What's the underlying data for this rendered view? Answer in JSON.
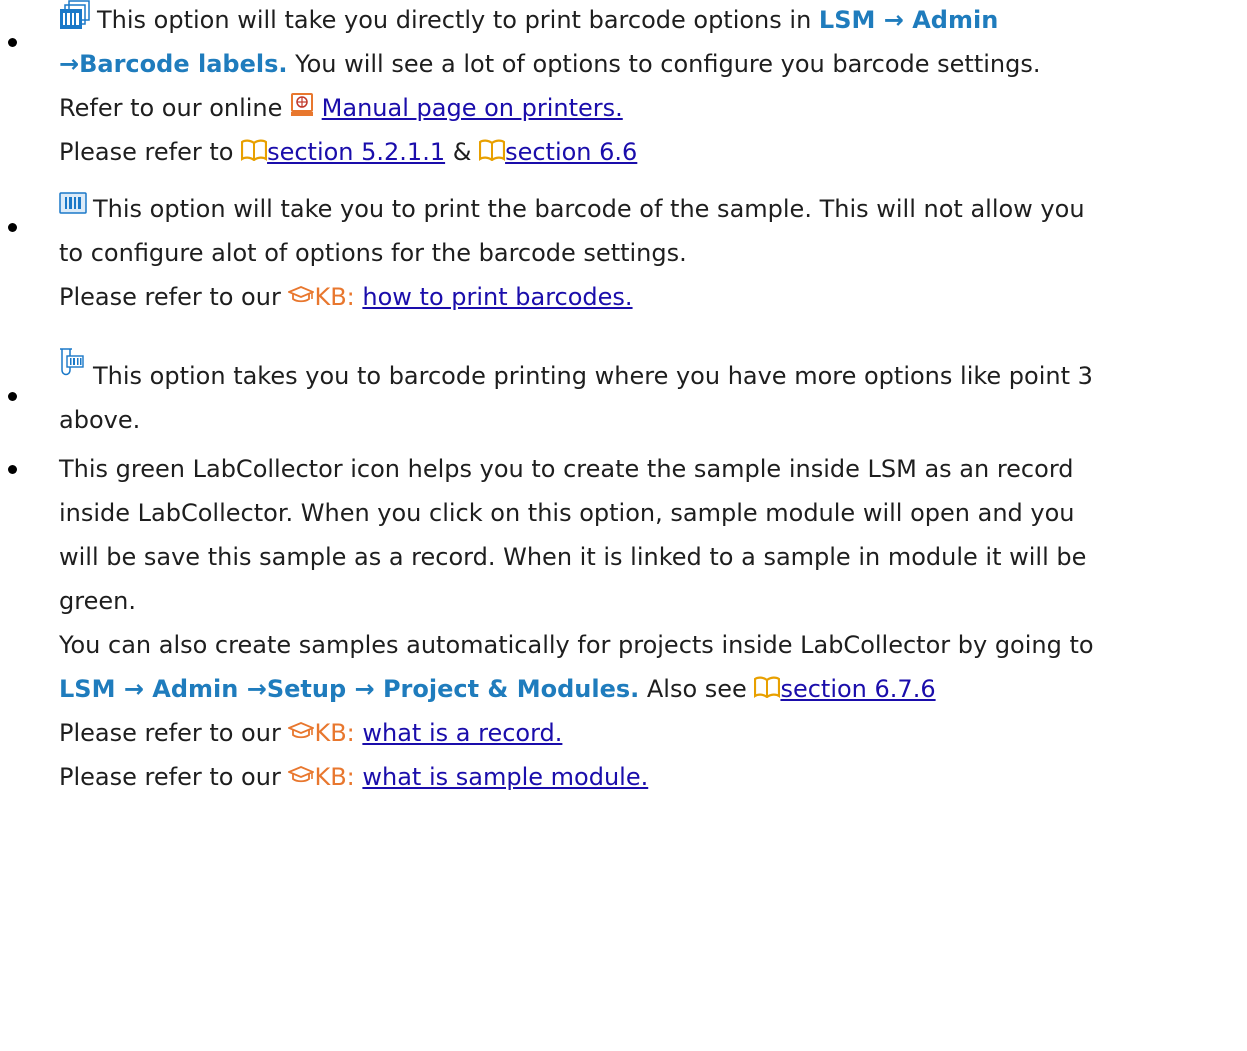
{
  "items": [
    {
      "lines": [
        {
          "text": "This option will take you directly to print barcode options in ",
          "path": "LSM → Admin"
        },
        {
          "path": "→Barcode labels.",
          "text": " You will see a lot of options to configure you barcode settings."
        },
        {
          "prefix": "Refer to our online ",
          "link": "Manual page on printers."
        },
        {
          "prefix": "Please refer to ",
          "link1": "section 5.2.1.1",
          "mid": " & ",
          "link2": "section 6.6"
        }
      ]
    },
    {
      "lines": [
        {
          "text": "This option will take you to print the barcode of the sample. This will not allow you"
        },
        {
          "text": "to configure alot of options for the barcode settings."
        },
        {
          "prefix": "Please refer to our ",
          "kb": "KB: ",
          "link": "how to print barcodes."
        }
      ]
    },
    {
      "lines": [
        {
          "text": "This option takes you to barcode printing where you have more options like point 3"
        },
        {
          "text": "above."
        }
      ]
    },
    {
      "lines": [
        {
          "text": "This green LabCollector icon helps you to create the sample inside LSM as an record"
        },
        {
          "text": "inside LabCollector. When you click on this option, sample module will open and you"
        },
        {
          "text": "will be save this sample as a record. When it is linked to a sample in module it will be"
        },
        {
          "text": "green."
        },
        {
          "text": "You can also create samples automatically for projects inside LabCollector by going to"
        },
        {
          "path": "LSM → Admin →Setup → Project & Modules.",
          "text": " Also see ",
          "link": "section 6.7.6"
        },
        {
          "prefix": "Please refer to our ",
          "kb": "KB: ",
          "link": "what is a record."
        },
        {
          "prefix": "Please refer to our ",
          "kb": "KB: ",
          "link": "what is sample module."
        }
      ]
    }
  ],
  "colors": {
    "path_blue": "#1f7cbd",
    "link": "#1a0dab",
    "kb_orange": "#e8772e",
    "icon_blue": "#1a78c8"
  },
  "icons": [
    "barcode-admin-icon",
    "globe-manual-icon",
    "book-icon",
    "barcode-print-icon",
    "tube-barcode-icon",
    "graduation-cap-icon"
  ]
}
